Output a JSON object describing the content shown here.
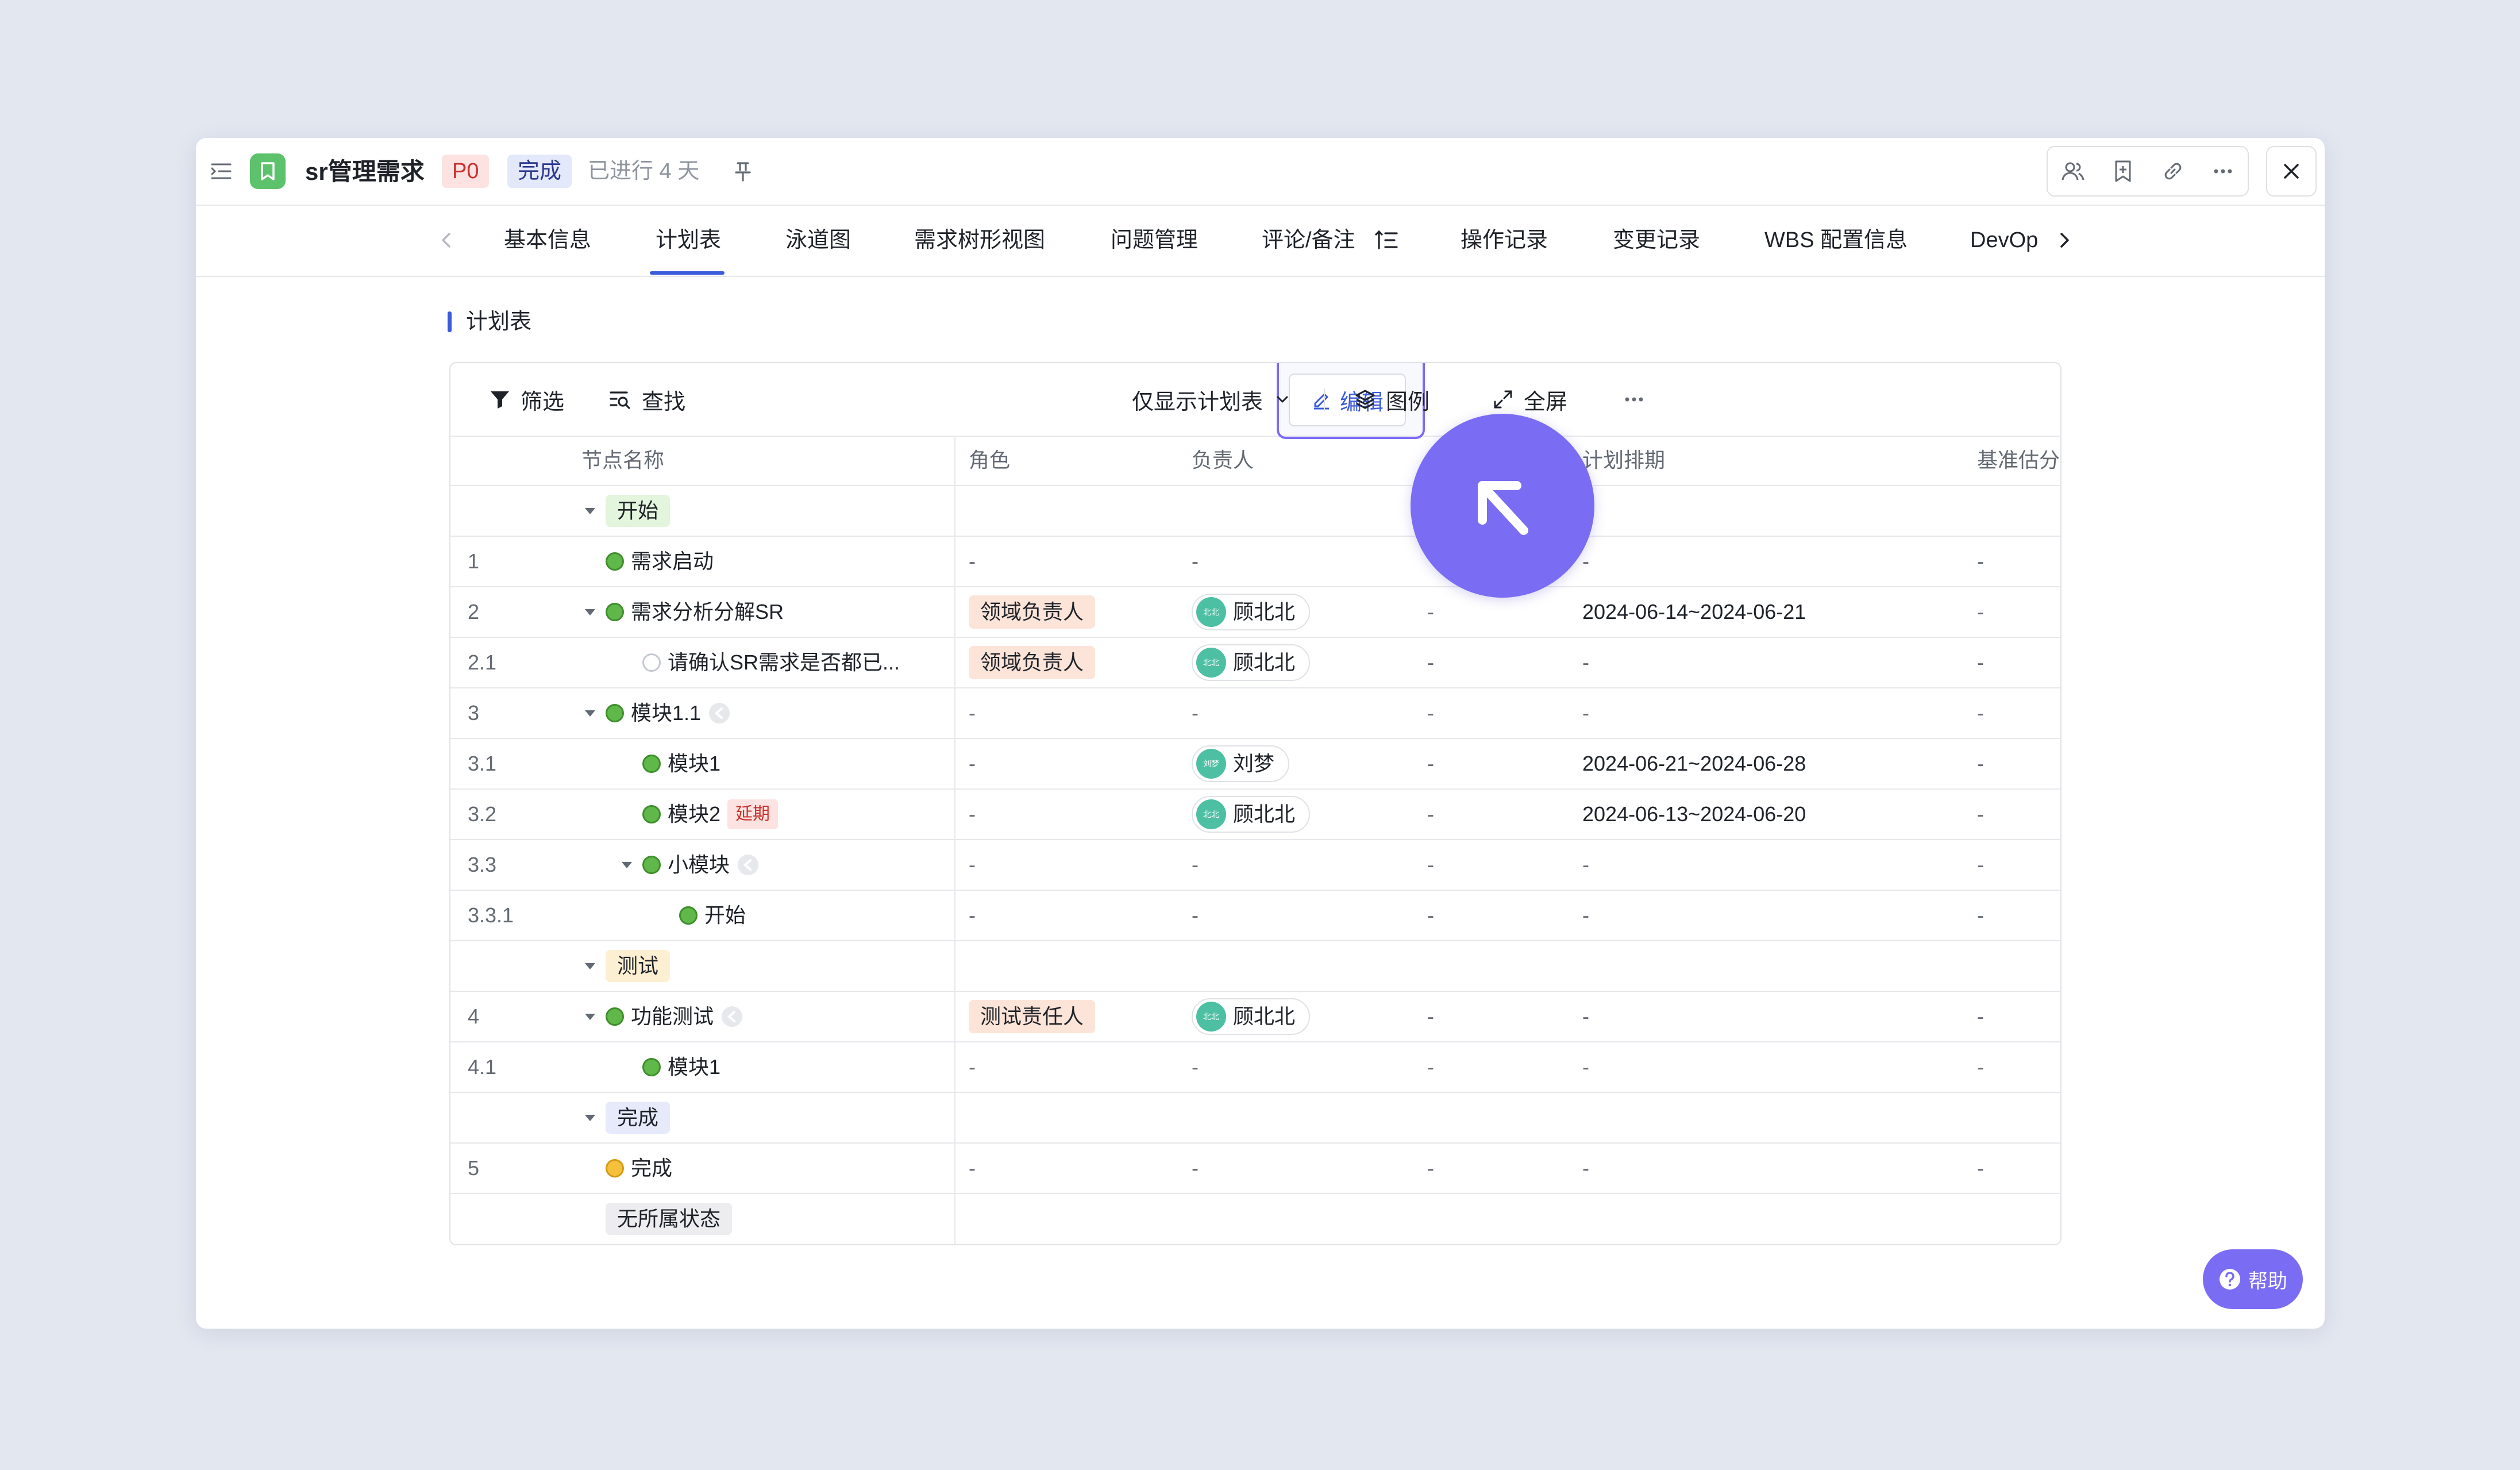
{
  "header": {
    "title": "sr管理需求",
    "priority": "P0",
    "status": "完成",
    "duration": "已进行 4 天"
  },
  "tabs": {
    "items": [
      "基本信息",
      "计划表",
      "泳道图",
      "需求树形视图",
      "问题管理",
      "评论/备注",
      "操作记录",
      "变更记录",
      "WBS 配置信息",
      "DevOp"
    ],
    "active": "计划表"
  },
  "section": {
    "title": "计划表"
  },
  "toolbar": {
    "filter": "筛选",
    "search": "查找",
    "edit": "编辑",
    "view_mode": "仅显示计划表",
    "legend": "图例",
    "fullscreen": "全屏"
  },
  "columns": {
    "name": "节点名称",
    "role": "角色",
    "owner": "负责人",
    "schedule": "计划排期",
    "estimate": "基准估分"
  },
  "rows": [
    {
      "type": "group",
      "label": "开始",
      "color": "#e3f5dd"
    },
    {
      "num": "1",
      "name": "需求启动",
      "role": "-",
      "owner": "-",
      "extra": "",
      "schedule": "-",
      "estimate": "-"
    },
    {
      "num": "2",
      "name": "需求分析分解SR",
      "role": "领域负责人",
      "owner": "顾北北",
      "avatar": "北北",
      "extra": "-",
      "schedule": "2024-06-14~2024-06-21",
      "estimate": "-"
    },
    {
      "num": "2.1",
      "name": "请确认SR需求是否都已...",
      "role": "领域负责人",
      "owner": "顾北北",
      "avatar": "北北",
      "extra": "-",
      "schedule": "-",
      "estimate": "-"
    },
    {
      "num": "3",
      "name": "模块1.1",
      "role": "-",
      "owner": "-",
      "extra": "-",
      "schedule": "-",
      "estimate": "-"
    },
    {
      "num": "3.1",
      "name": "模块1",
      "role": "-",
      "owner": "刘梦",
      "avatar": "刘梦",
      "extra": "-",
      "schedule": "2024-06-21~2024-06-28",
      "estimate": "-"
    },
    {
      "num": "3.2",
      "name": "模块2",
      "delay": "延期",
      "role": "-",
      "owner": "顾北北",
      "avatar": "北北",
      "extra": "-",
      "schedule": "2024-06-13~2024-06-20",
      "estimate": "-"
    },
    {
      "num": "3.3",
      "name": "小模块",
      "role": "-",
      "owner": "-",
      "extra": "-",
      "schedule": "-",
      "estimate": "-"
    },
    {
      "num": "3.3.1",
      "name": "开始",
      "role": "-",
      "owner": "-",
      "extra": "-",
      "schedule": "-",
      "estimate": "-"
    },
    {
      "type": "group",
      "label": "测试",
      "color": "#fdf0d2"
    },
    {
      "num": "4",
      "name": "功能测试",
      "role": "测试责任人",
      "owner": "顾北北",
      "avatar": "北北",
      "extra": "-",
      "schedule": "-",
      "estimate": "-"
    },
    {
      "num": "4.1",
      "name": "模块1",
      "role": "-",
      "owner": "-",
      "extra": "-",
      "schedule": "-",
      "estimate": "-"
    },
    {
      "type": "group",
      "label": "完成",
      "color": "#e6eafb"
    },
    {
      "num": "5",
      "name": "完成",
      "role": "-",
      "owner": "-",
      "extra": "-",
      "schedule": "-",
      "estimate": "-"
    },
    {
      "type": "group",
      "label": "无所属状态",
      "color": "#ededef"
    }
  ],
  "help": "帮助",
  "colors": {
    "accent": "#3b5bdb",
    "cursor": "#7a6cf3",
    "app_badge": "#5cc26b"
  }
}
